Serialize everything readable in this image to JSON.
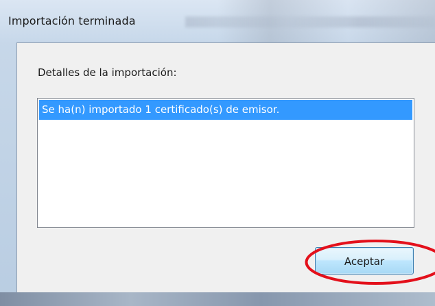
{
  "window": {
    "title": "Importación terminada"
  },
  "dialog": {
    "details_label": "Detalles de la importación:",
    "list_items": [
      "Se ha(n) importado 1 certificado(s) de emisor."
    ],
    "ok_label": "Aceptar"
  },
  "colors": {
    "selection": "#3399ff",
    "highlight_annotation": "#e3101b"
  }
}
